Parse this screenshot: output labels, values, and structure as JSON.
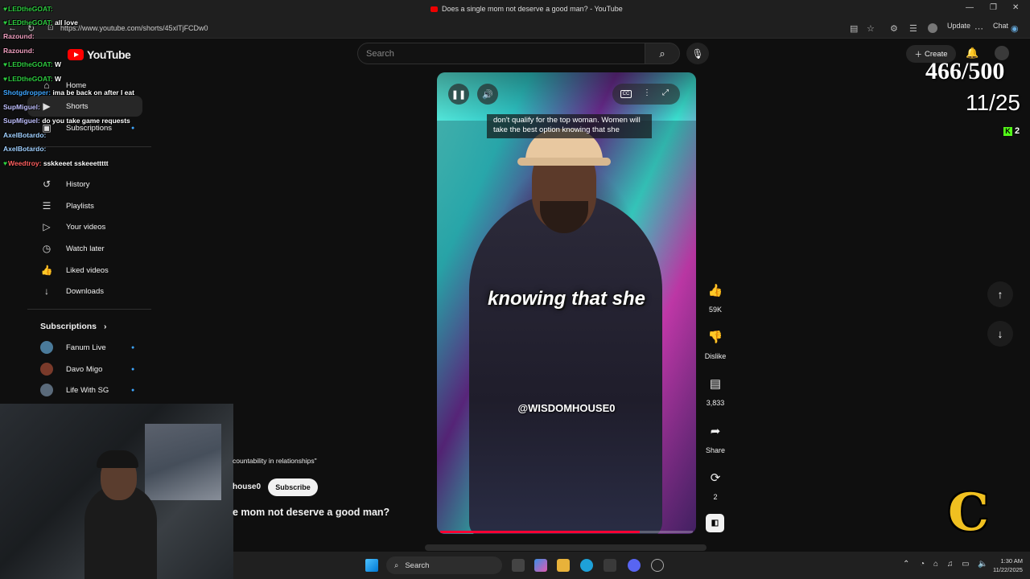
{
  "window": {
    "title": "Does a single mom not deserve a good man? - YouTube",
    "url": "https://www.youtube.com/shorts/45xlTjFCDw0",
    "update_label": "Update",
    "chat_label": "Chat"
  },
  "header": {
    "logo_text": "YouTube",
    "search_placeholder": "Search",
    "create_label": "Create"
  },
  "sidebar": {
    "items": [
      {
        "label": "Home",
        "icon": "home-icon"
      },
      {
        "label": "Shorts",
        "icon": "shorts-icon"
      },
      {
        "label": "Subscriptions",
        "icon": "subscriptions-icon"
      },
      {
        "label": "History",
        "icon": "history-icon"
      },
      {
        "label": "Playlists",
        "icon": "playlists-icon"
      },
      {
        "label": "Your videos",
        "icon": "your-videos-icon"
      },
      {
        "label": "Watch later",
        "icon": "clock-icon"
      },
      {
        "label": "Liked videos",
        "icon": "thumbs-up-icon"
      },
      {
        "label": "Downloads",
        "icon": "download-icon"
      }
    ],
    "subscriptions_heading": "Subscriptions",
    "subscriptions": [
      {
        "name": "Fanum Live",
        "color": "#4a7a9a"
      },
      {
        "name": "Davo Migo",
        "color": "#7a3a2a"
      },
      {
        "name": "Life With SG",
        "color": "#5a6a7a"
      }
    ]
  },
  "chat_overlay": [
    {
      "user": "LEDtheGOAT:",
      "msg": "",
      "color": "#2ecc40"
    },
    {
      "user": "LEDtheGOAT:",
      "msg": "all love",
      "color": "#2ecc40"
    },
    {
      "user": "Razound:",
      "msg": "",
      "color": "#f0a0c0"
    },
    {
      "user": "Razound:",
      "msg": "",
      "color": "#f0a0c0"
    },
    {
      "user": "LEDtheGOAT:",
      "msg": "W",
      "color": "#2ecc40"
    },
    {
      "user": "LEDtheGOAT:",
      "msg": "W",
      "color": "#2ecc40"
    },
    {
      "user": "Shotgdropper:",
      "msg": "ima be back on after I eat",
      "color": "#3ea6ff"
    },
    {
      "user": "SupMiguel:",
      "msg": "",
      "color": "#c0c0ff"
    },
    {
      "user": "SupMiguel:",
      "msg": "do you take game requests",
      "color": "#c0c0ff"
    },
    {
      "user": "AxelBotardo:",
      "msg": "",
      "color": "#a0d0ff"
    },
    {
      "user": "AxelBotardo:",
      "msg": "",
      "color": "#a0d0ff"
    },
    {
      "user": "Weedtroy:",
      "msg": "sskkeeet sskeeettttt",
      "color": "#ff6060"
    }
  ],
  "video": {
    "caption_text": "don't qualify for the top woman. Women will take the best option knowing that she",
    "big_caption": "knowing that she",
    "watermark": "@WISDOMHOUSE0",
    "progress": 0.79,
    "description": "countability in relationships\"",
    "channel": "house0",
    "subscribe_label": "Subscribe",
    "title": "e mom not deserve a good man?"
  },
  "actions": {
    "like_count": "59K",
    "dislike_label": "Dislike",
    "comment_count": "3,833",
    "share_label": "Share",
    "remix_count": "2"
  },
  "stream": {
    "counter_main": "466/500",
    "counter_sub": "11/25",
    "kick_viewers": "2",
    "logo_letter": "C"
  },
  "taskbar": {
    "search_label": "Search",
    "time": "1:30 AM",
    "date": "11/22/2025"
  }
}
